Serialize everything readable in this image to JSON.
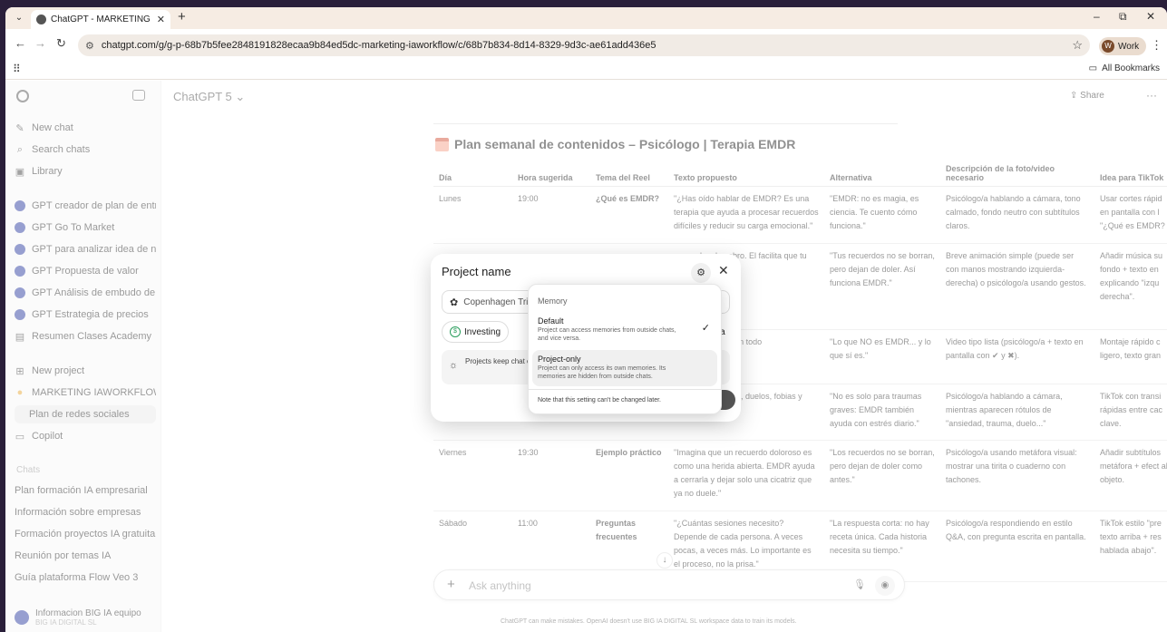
{
  "browser": {
    "tab_title": "ChatGPT - MARKETING IAWORK",
    "url": "chatgpt.com/g/g-p-68b7b5fee2848191828ecaa9b84ed5dc-marketing-iaworkflow/c/68b7b834-8d14-8329-9d3c-ae61add436e5",
    "profile_label": "Work",
    "profile_initial": "W",
    "all_bookmarks": "All Bookmarks"
  },
  "sidebar": {
    "top_items": [
      "New chat",
      "Search chats",
      "Library"
    ],
    "gpts": [
      "GPT creador de plan de entr...",
      "GPT Go To Market",
      "GPT para analizar idea de ne...",
      "GPT Propuesta de valor",
      "GPT Análisis de embudo de ...",
      "GPT Estrategia de precios"
    ],
    "resumen": "Resumen Clases Academy",
    "new_project": "New project",
    "project": "MARKETING IAWORKFLOW",
    "active_chat": "Plan de redes sociales",
    "copilot": "Copilot",
    "chats_label": "Chats",
    "chats": [
      "Plan formación IA empresarial",
      "Información sobre empresas",
      "Formación proyectos IA gratuita",
      "Reunión por temas IA",
      "Guía plataforma Flow Veo 3"
    ],
    "user_name": "Informacion BIG IA equipo",
    "user_org": "BIG IA DIGITAL SL"
  },
  "header": {
    "model": "ChatGPT 5",
    "share": "Share"
  },
  "doc": {
    "title": "Plan semanal de contenidos – Psicólogo | Terapia EMDR",
    "columns": [
      "Día",
      "Hora sugerida",
      "Tema del Reel",
      "Texto propuesto",
      "Alternativa",
      "Descripción de la foto/video necesario",
      "Idea para TikTok"
    ],
    "rows": [
      [
        "Lunes",
        "19:00",
        "¿Qué es EMDR?",
        "\"¿Has oído hablar de EMDR? Es una terapia que ayuda a procesar recuerdos difíciles y reducir su carga emocional.\"",
        "\"EMDR: no es magia, es ciencia. Te cuento cómo funciona.\"",
        "Psicólogo/a hablando a cámara, tono calmado, fondo neutro con subtítulos claros.",
        "Usar cortes rápid en pantalla con l \"¿Qué es EMDR?"
      ],
      [
        "",
        "",
        "",
        "os con los dos ebro. El facilita que tu erdos",
        "\"Tus recuerdos no se borran, pero dejan de doler. Así funciona EMDR.\"",
        "Breve animación simple (puede ser con manos mostrando izquierda-derecha) o psicólogo/a usando gestos.",
        "Añadir música su fondo + texto en explicando \"izqu derecha\"."
      ],
      [
        "",
        "",
        "",
        "nosis. ✖ sciente en todo",
        "\"Lo que NO es EMDR... y lo que sí es.\"",
        "Video tipo lista (psicólogo/a + texto en pantalla con ✔ y ✖).",
        "Montaje rápido c ligero, texto gran"
      ],
      [
        "",
        "",
        "sirve?",
        "ansiedad, traumas, duelos, fobias y mucho más.\"",
        "\"No es solo para traumas graves: EMDR también ayuda con estrés diario.\"",
        "Psicólogo/a hablando a cámara, mientras aparecen rótulos de \"ansiedad, trauma, duelo...\"",
        "TikTok con transi rápidas entre cac clave."
      ],
      [
        "Viernes",
        "19:30",
        "Ejemplo práctico",
        "\"Imagina que un recuerdo doloroso es como una herida abierta. EMDR ayuda a cerrarla y dejar solo una cicatriz que ya no duele.\"",
        "\"Los recuerdos no se borran, pero dejan de doler como antes.\"",
        "Psicólogo/a usando metáfora visual: mostrar una tirita o cuaderno con tachones.",
        "Añadir subtítulos metáfora + efect al objeto."
      ],
      [
        "Sábado",
        "11:00",
        "Preguntas frecuentes",
        "\"¿Cuántas sesiones necesito? Depende de cada persona. A veces pocas, a veces más. Lo importante es el proceso, no la prisa.\"",
        "\"La respuesta corta: no hay receta única. Cada historia necesita su tiempo.\"",
        "Psicólogo/a respondiendo en estilo Q&A, con pregunta escrita en pantalla.",
        "TikTok estilo \"pre texto arriba + res hablada abajo\"."
      ]
    ]
  },
  "composer": {
    "placeholder": "Ask anything",
    "disclaimer": "ChatGPT can make mistakes. OpenAI doesn't use BIG IA DIGITAL SL workspace data to train its models."
  },
  "modal": {
    "title": "Project name",
    "input_value": "Copenhagen Tri",
    "chips": [
      "Investing",
      "Tra"
    ],
    "info_text": "Projects keep chat ongoing work, or",
    "create_label": "ct"
  },
  "memory": {
    "heading": "Memory",
    "options": [
      {
        "title": "Default",
        "desc": "Project can access memories from outside chats, and vice versa."
      },
      {
        "title": "Project-only",
        "desc": "Project can only access its own memories. Its memories are hidden from outside chats."
      }
    ],
    "note": "Note that this setting can't be changed later."
  }
}
